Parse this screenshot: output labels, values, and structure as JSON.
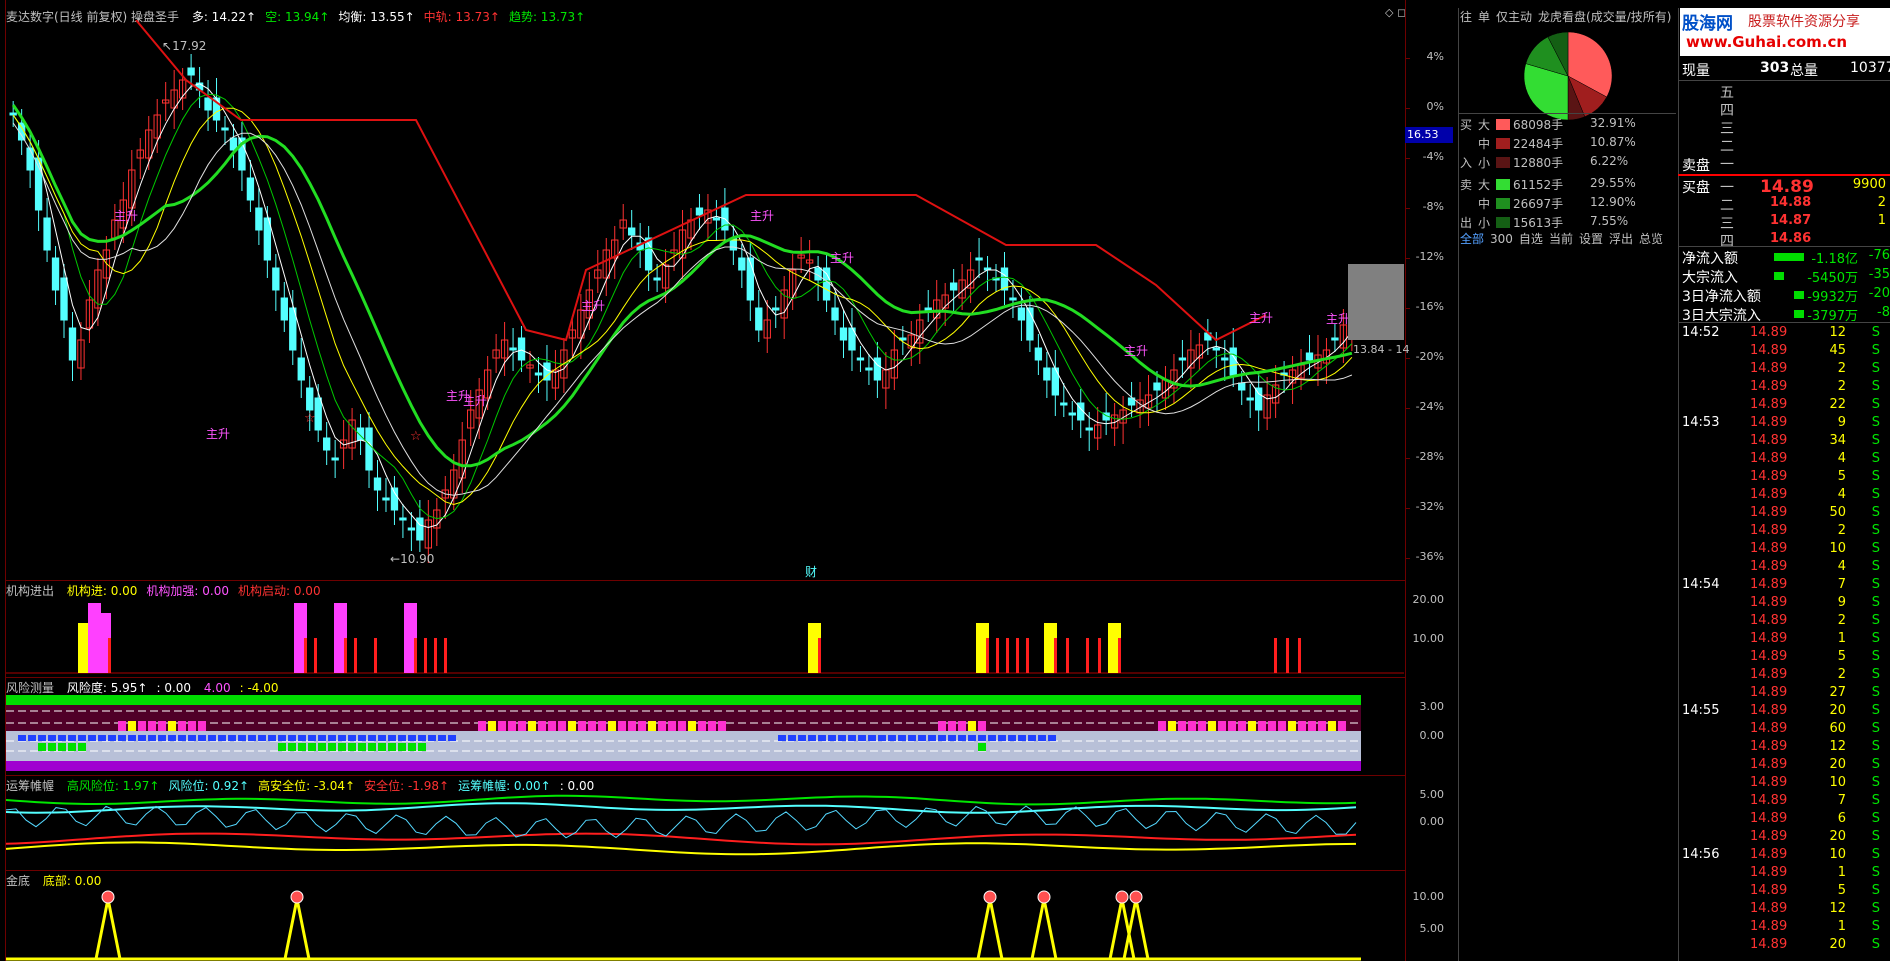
{
  "main_title": {
    "indicator": "麦达数字(日线 前复权) 操盘圣手",
    "items": [
      {
        "label": "多:",
        "value": "14.22",
        "arrow": "↑",
        "color": "#ffffff"
      },
      {
        "label": "空:",
        "value": "13.94",
        "arrow": "↑",
        "color": "#00e600"
      },
      {
        "label": "均衡:",
        "value": "13.55",
        "arrow": "↑",
        "color": "#ffffff"
      },
      {
        "label": "中轨:",
        "value": "13.73",
        "arrow": "↑",
        "color": "#ff3232"
      },
      {
        "label": "趋势:",
        "value": "13.73",
        "arrow": "↑",
        "color": "#00e600"
      }
    ]
  },
  "main_axis": [
    "4%",
    "0%",
    "-4%",
    "-8%",
    "-12%",
    "-16%",
    "-20%",
    "-24%",
    "-28%",
    "-32%",
    "-36%"
  ],
  "price_badge": "16.53",
  "price_annotations": {
    "high": "17.92",
    "low": "10.90",
    "last": "13.84 - 14",
    "cai": "财"
  },
  "chart_tags": [
    "主升",
    "主升",
    "主升",
    "主升",
    "主升",
    "主升",
    "主升",
    "主升",
    "主升",
    "主升"
  ],
  "panel2": {
    "name": "机构进出",
    "items": [
      {
        "label": "机构进:",
        "value": "0.00",
        "color": "#ffff00"
      },
      {
        "label": "机构加强:",
        "value": "0.00",
        "color": "#ff54ff"
      },
      {
        "label": "机构启动:",
        "value": "0.00",
        "color": "#ff3232"
      }
    ],
    "axis": [
      "20.00",
      "10.00"
    ]
  },
  "panel3": {
    "name": "风险测量",
    "items": [
      {
        "label": "风险度:",
        "value": "5.95",
        "arrow": "↑",
        "color": "#ffffff"
      },
      {
        "label": ":",
        "value": "0.00",
        "arrow": "",
        "color": "#ffffff"
      },
      {
        "label": "",
        "value": "4.00",
        "arrow": "",
        "color": "#ff54ff"
      },
      {
        "label": ":",
        "value": "-4.00",
        "arrow": "",
        "color": "#ffff00"
      }
    ],
    "axis": [
      "3.00",
      "0.00"
    ]
  },
  "panel4": {
    "name": "运筹帷幄",
    "items": [
      {
        "label": "高风险位:",
        "value": "1.97",
        "arrow": "↑",
        "color": "#00e600"
      },
      {
        "label": "风险位:",
        "value": "0.92",
        "arrow": "↑",
        "color": "#54ffff"
      },
      {
        "label": "高安全位:",
        "value": "-3.04",
        "arrow": "↑",
        "color": "#ffff00"
      },
      {
        "label": "安全位:",
        "value": "-1.98",
        "arrow": "↑",
        "color": "#ff3232"
      },
      {
        "label": "运筹帷幄:",
        "value": "0.00",
        "arrow": "↑",
        "color": "#54ffff"
      },
      {
        "label": ":",
        "value": "0.00",
        "arrow": "",
        "color": "#ffffff"
      }
    ],
    "axis": [
      "5.00",
      "0.00"
    ]
  },
  "panel5": {
    "name": "金底",
    "items": [
      {
        "label": "底部:",
        "value": "0.00",
        "color": "#ffff00"
      }
    ],
    "axis": [
      "10.00",
      "5.00"
    ]
  },
  "right_tabs": [
    "往",
    "单",
    "仅主动",
    "龙虎看盘(成交量/技所有)"
  ],
  "flow_buy_label": [
    "买",
    "入"
  ],
  "flow_sell_label": [
    "卖",
    "出"
  ],
  "flow_rows": [
    {
      "size": "大",
      "color": "#ff5a5a",
      "vol": "68098手",
      "pct": "32.91%"
    },
    {
      "size": "中",
      "color": "#a01e1e",
      "vol": "22484手",
      "pct": "10.87%"
    },
    {
      "size": "小",
      "color": "#5a1414",
      "vol": "12880手",
      "pct": "6.22%"
    },
    {
      "size": "大",
      "color": "#33dd33",
      "vol": "61152手",
      "pct": "29.55%"
    },
    {
      "size": "中",
      "color": "#1f8f1f",
      "vol": "26697手",
      "pct": "12.90%"
    },
    {
      "size": "小",
      "color": "#145f14",
      "vol": "15613手",
      "pct": "7.55%"
    }
  ],
  "bottom_links": [
    "全部",
    "300",
    "自选",
    "当前",
    "设置",
    "浮出",
    "总览"
  ],
  "watermark": {
    "logo": "股海网",
    "slogan": "股票软件资源分享",
    "url": "www.Guhai.com.cn"
  },
  "quote": {
    "xianliang_label": "现量",
    "xianliang": "303",
    "zongliang_label": "总量",
    "zongliang": "10377",
    "sell_label": "卖盘",
    "buy_label": "买盘",
    "sell_levels": [
      "五",
      "四",
      "三",
      "二",
      "一"
    ],
    "buy_levels": [
      {
        "lvl": "一",
        "price": "14.89",
        "vol": "9900"
      },
      {
        "lvl": "二",
        "price": "14.88",
        "vol": "2"
      },
      {
        "lvl": "三",
        "price": "14.87",
        "vol": "1"
      },
      {
        "lvl": "四",
        "price": "14.86",
        "vol": ""
      }
    ],
    "flows": [
      {
        "label": "净流入额",
        "value": "-1.18亿",
        "extra": "-76"
      },
      {
        "label": "大宗流入",
        "value": "-5450万",
        "extra": "-35"
      },
      {
        "label": "3日净流入额",
        "value": "-9932万",
        "extra": "-20"
      },
      {
        "label": "3日大宗流入",
        "value": "-3797万",
        "extra": "-8"
      }
    ]
  },
  "ticks": [
    {
      "time": "14:52",
      "price": "14.89",
      "vol": "12",
      "bs": "S"
    },
    {
      "time": "",
      "price": "14.89",
      "vol": "45",
      "bs": "S"
    },
    {
      "time": "",
      "price": "14.89",
      "vol": "2",
      "bs": "S"
    },
    {
      "time": "",
      "price": "14.89",
      "vol": "2",
      "bs": "S"
    },
    {
      "time": "",
      "price": "14.89",
      "vol": "22",
      "bs": "S"
    },
    {
      "time": "14:53",
      "price": "14.89",
      "vol": "9",
      "bs": "S"
    },
    {
      "time": "",
      "price": "14.89",
      "vol": "34",
      "bs": "S"
    },
    {
      "time": "",
      "price": "14.89",
      "vol": "4",
      "bs": "S"
    },
    {
      "time": "",
      "price": "14.89",
      "vol": "5",
      "bs": "S"
    },
    {
      "time": "",
      "price": "14.89",
      "vol": "4",
      "bs": "S"
    },
    {
      "time": "",
      "price": "14.89",
      "vol": "50",
      "bs": "S"
    },
    {
      "time": "",
      "price": "14.89",
      "vol": "2",
      "bs": "S"
    },
    {
      "time": "",
      "price": "14.89",
      "vol": "10",
      "bs": "S"
    },
    {
      "time": "",
      "price": "14.89",
      "vol": "4",
      "bs": "S"
    },
    {
      "time": "14:54",
      "price": "14.89",
      "vol": "7",
      "bs": "S"
    },
    {
      "time": "",
      "price": "14.89",
      "vol": "9",
      "bs": "S"
    },
    {
      "time": "",
      "price": "14.89",
      "vol": "2",
      "bs": "S"
    },
    {
      "time": "",
      "price": "14.89",
      "vol": "1",
      "bs": "S"
    },
    {
      "time": "",
      "price": "14.89",
      "vol": "5",
      "bs": "S"
    },
    {
      "time": "",
      "price": "14.89",
      "vol": "2",
      "bs": "S"
    },
    {
      "time": "",
      "price": "14.89",
      "vol": "27",
      "bs": "S"
    },
    {
      "time": "14:55",
      "price": "14.89",
      "vol": "20",
      "bs": "S"
    },
    {
      "time": "",
      "price": "14.89",
      "vol": "60",
      "bs": "S"
    },
    {
      "time": "",
      "price": "14.89",
      "vol": "12",
      "bs": "S"
    },
    {
      "time": "",
      "price": "14.89",
      "vol": "20",
      "bs": "S"
    },
    {
      "time": "",
      "price": "14.89",
      "vol": "10",
      "bs": "S"
    },
    {
      "time": "",
      "price": "14.89",
      "vol": "7",
      "bs": "S"
    },
    {
      "time": "",
      "price": "14.89",
      "vol": "6",
      "bs": "S"
    },
    {
      "time": "",
      "price": "14.89",
      "vol": "20",
      "bs": "S"
    },
    {
      "time": "14:56",
      "price": "14.89",
      "vol": "10",
      "bs": "S"
    },
    {
      "time": "",
      "price": "14.89",
      "vol": "1",
      "bs": "S"
    },
    {
      "time": "",
      "price": "14.89",
      "vol": "5",
      "bs": "S"
    },
    {
      "time": "",
      "price": "14.89",
      "vol": "12",
      "bs": "S"
    },
    {
      "time": "",
      "price": "14.89",
      "vol": "1",
      "bs": "S"
    },
    {
      "time": "",
      "price": "14.89",
      "vol": "20",
      "bs": "S"
    }
  ],
  "pie": [
    32.91,
    10.87,
    6.22,
    29.55,
    12.9,
    7.55
  ],
  "colors": {
    "up": "#ff3232",
    "down": "#54ffff",
    "grid": "#6e0000",
    "green": "#00e600",
    "yellow": "#ffff00",
    "magenta": "#ff54ff"
  }
}
